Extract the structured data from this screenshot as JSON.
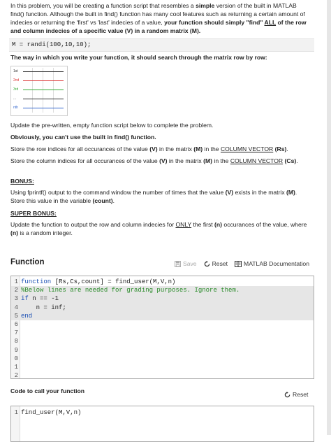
{
  "problem": {
    "intro_1": "In this problem, you will be creating a function script that resembles a ",
    "intro_simple": "simple",
    "intro_2": " version of the built in MATLAB find() function. Although the built in find() function has many cool features such as returning a certain amount of indecies or returning the 'first' vs 'last' indecies of a value, ",
    "intro_bold_1": "your function should simply \"find\" ",
    "intro_all": "ALL",
    "intro_bold_2": " of the row and column indecies of a specific value (V) in a random matrix (M).",
    "matrix_code": "M = randi(100,10,10);",
    "search_note": "The way in which you write your function, it should search through the matrix row by row:",
    "diagram_labels": [
      "1st",
      "2nd",
      "3rd",
      "...",
      "nth"
    ],
    "update_note": "Update the pre-written, empty function script below to complete the problem.",
    "no_find": "Obviously, you can't use the built in find() function.",
    "store_rows_1": "Store the row indices for all occurances of the value ",
    "store_rows_v": "(V)",
    "store_rows_2": " in the matrix ",
    "store_rows_m": "(M)",
    "store_rows_3": " in the ",
    "store_rows_cv": "COLUMN VECTOR",
    "store_rows_rs": "(Rs)",
    "store_cols_1": "Store the column indices for all occurances of the value ",
    "store_cols_v": "(V)",
    "store_cols_2": " in the matrix ",
    "store_cols_m": "(M)",
    "store_cols_3": " in the ",
    "store_cols_cv": "COLUMN VECTOR",
    "store_cols_cs": "(Cs)",
    "bonus_heading": "BONUS:",
    "bonus_1": "Using fprintf() output to the command window the number of times that the value ",
    "bonus_v": "(V)",
    "bonus_2": " exists in the matrix ",
    "bonus_m": "(M)",
    "bonus_3": ". Store this value in the variable ",
    "bonus_count": "(count)",
    "super_heading": "SUPER BONUS:",
    "super_1": "Update the function to output the row and column indecies for ",
    "super_only": "ONLY",
    "super_2": " the first ",
    "super_n": "(n)",
    "super_3": " occurances of the value, where ",
    "super_n2": "(n)",
    "super_4": " is a random integer."
  },
  "function_section": {
    "title": "Function",
    "save_label": "Save",
    "reset_label": "Reset",
    "doc_label": "MATLAB Documentation",
    "code_lines": [
      {
        "num": "1",
        "text": "function [Rs,Cs,count] = find_user(M,V,n)"
      },
      {
        "num": "2",
        "text": "%Below lines are needed for grading purposes. Ignore them."
      },
      {
        "num": "3",
        "text": "if n == -1"
      },
      {
        "num": "4",
        "text": "    n = inf;"
      },
      {
        "num": "5",
        "text": "end"
      },
      {
        "num": "6",
        "text": ""
      },
      {
        "num": "7",
        "text": ""
      },
      {
        "num": "8",
        "text": ""
      },
      {
        "num": "9",
        "text": ""
      },
      {
        "num": "0",
        "text": ""
      },
      {
        "num": "1",
        "text": ""
      },
      {
        "num": "2",
        "text": ""
      }
    ]
  },
  "call_section": {
    "title": "Code to call your function",
    "reset_label": "Reset",
    "code_lines": [
      {
        "num": "1",
        "text": "find_user(M,V,n)"
      }
    ]
  },
  "colors": {
    "keyword": "#1a4fb3",
    "comment": "#2a8b2a",
    "locked_bg": "#e6e6e6"
  }
}
